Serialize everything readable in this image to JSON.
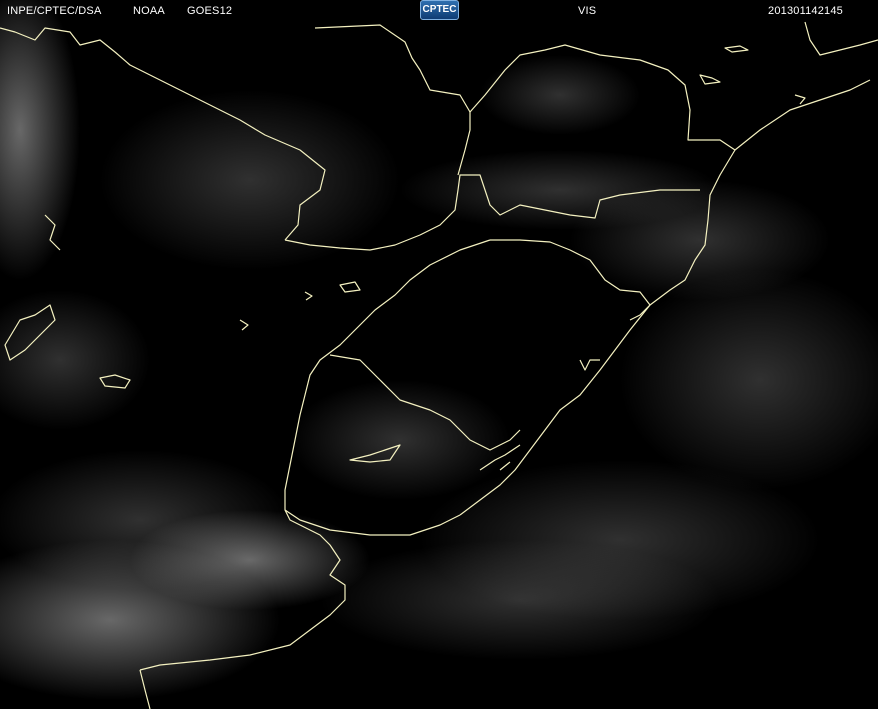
{
  "header": {
    "source": "INPE/CPTEC/DSA",
    "agency": "NOAA",
    "satellite": "GOES12",
    "logo_text": "CPTEC",
    "channel": "VIS",
    "timestamp": "201301142145"
  },
  "colors": {
    "background": "#000000",
    "borders": "#f4f1c0",
    "text": "#ffffff",
    "cloud": "#9a9a9a"
  }
}
